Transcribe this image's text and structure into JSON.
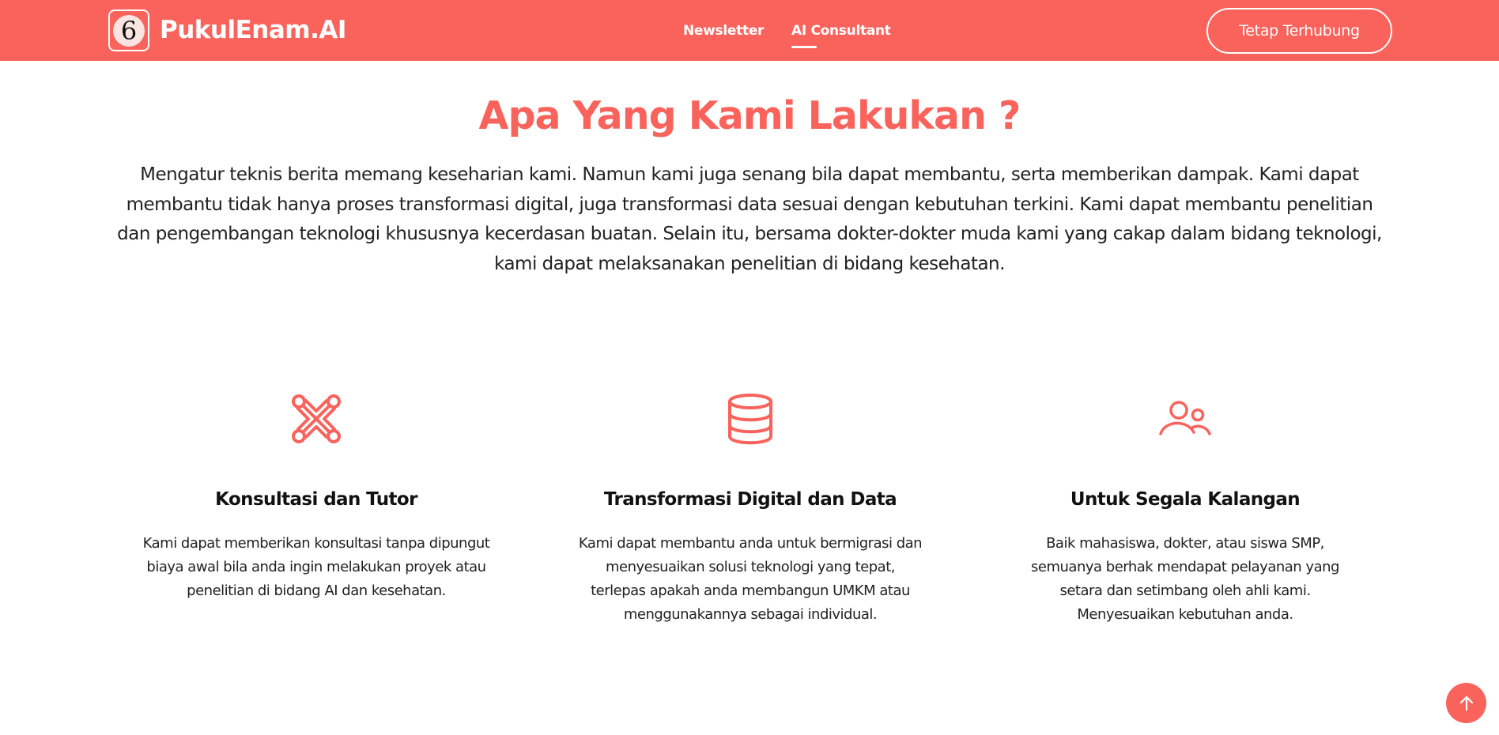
{
  "header": {
    "brand": "PukulEnam.AI",
    "logo_glyph": "6",
    "nav": [
      {
        "label": "Newsletter"
      },
      {
        "label": "AI Consultant"
      }
    ],
    "cta_label": "Tetap Terhubung",
    "active_nav": "AI Consultant"
  },
  "main": {
    "title": "Apa Yang Kami Lakukan ?",
    "description": "Mengatur teknis berita memang keseharian kami. Namun kami juga senang bila dapat membantu, serta memberikan dampak. Kami dapat membantu tidak hanya proses transformasi digital, juga transformasi data sesuai dengan kebutuhan terkini. Kami dapat membantu penelitian dan pengembangan teknologi khususnya kecerdasan buatan. Selain itu, bersama dokter-dokter muda kami yang cakap dalam bidang teknologi, kami dapat melaksanakan penelitian di bidang kesehatan.",
    "features": [
      {
        "icon": "joomla-icon",
        "title": "Konsultasi dan Tutor",
        "description": "Kami dapat memberikan konsultasi tanpa dipungut biaya awal bila anda ingin melakukan proyek atau penelitian di bidang AI dan kesehatan."
      },
      {
        "icon": "database-icon",
        "title": "Transformasi Digital dan Data",
        "description": "Kami dapat membantu anda untuk bermigrasi dan menyesuaikan solusi teknologi yang tepat, terlepas apakah anda membangun UMKM atau menggunakannya sebagai individual."
      },
      {
        "icon": "users-icon",
        "title": "Untuk Segala Kalangan",
        "description": "Baik mahasiswa, dokter, atau siswa SMP, semuanya berhak mendapat pelayanan yang setara dan setimbang oleh ahli kami. Menyesuaikan kebutuhan anda."
      }
    ]
  },
  "scroll_top_icon": "arrow-up-icon",
  "colors": {
    "accent": "#f9635b",
    "text": "#222222",
    "heading": "#111111",
    "background": "#ffffff"
  }
}
